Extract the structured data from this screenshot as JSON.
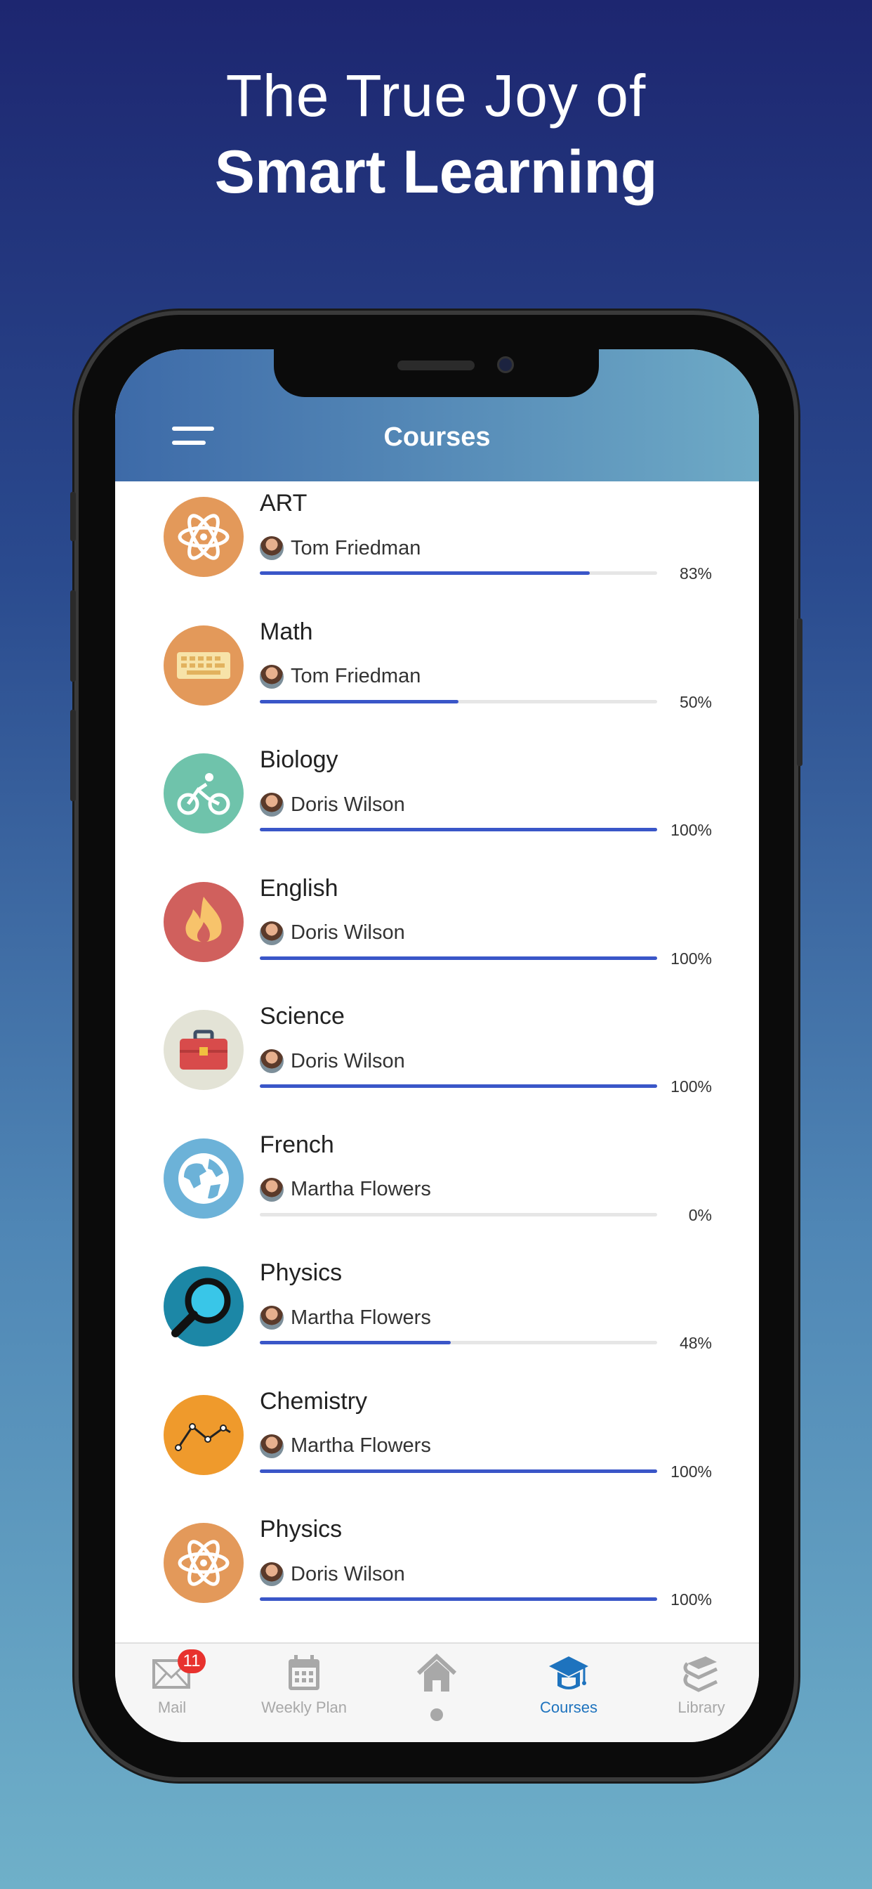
{
  "promo": {
    "line1": "The True Joy of",
    "line2": "Smart Learning"
  },
  "header": {
    "title": "Courses",
    "menu_icon": "hamburger-menu-icon"
  },
  "colors": {
    "progress": "#3a56c8",
    "active_tab": "#1e73be",
    "badge": "#e8322e"
  },
  "courses": [
    {
      "name": "ART",
      "teacher": "Tom Friedman",
      "progress": 83,
      "percent_label": "83%",
      "icon": "atom-icon",
      "icon_bg": "#e3995a"
    },
    {
      "name": "Math",
      "teacher": "Tom Friedman",
      "progress": 50,
      "percent_label": "50%",
      "icon": "keyboard-icon",
      "icon_bg": "#e3995a"
    },
    {
      "name": "Biology",
      "teacher": "Doris Wilson",
      "progress": 100,
      "percent_label": "100%",
      "icon": "bicycle-icon",
      "icon_bg": "#6fc3ab"
    },
    {
      "name": "English",
      "teacher": "Doris Wilson",
      "progress": 100,
      "percent_label": "100%",
      "icon": "flame-icon",
      "icon_bg": "#d0605d"
    },
    {
      "name": "Science",
      "teacher": "Doris Wilson",
      "progress": 100,
      "percent_label": "100%",
      "icon": "toolbox-icon",
      "icon_bg": "#e3e3d6"
    },
    {
      "name": "French",
      "teacher": "Martha Flowers",
      "progress": 0,
      "percent_label": "0%",
      "icon": "globe-icon",
      "icon_bg": "#6cb2d8"
    },
    {
      "name": "Physics",
      "teacher": "Martha Flowers",
      "progress": 48,
      "percent_label": "48%",
      "icon": "magnifier-icon",
      "icon_bg": "#1c87a6"
    },
    {
      "name": "Chemistry",
      "teacher": "Martha Flowers",
      "progress": 100,
      "percent_label": "100%",
      "icon": "line-chart-icon",
      "icon_bg": "#ef9a2c"
    },
    {
      "name": "Physics",
      "teacher": "Doris Wilson",
      "progress": 100,
      "percent_label": "100%",
      "icon": "atom-icon",
      "icon_bg": "#e3995a"
    }
  ],
  "tabs": [
    {
      "label": "Mail",
      "icon": "mail-icon",
      "badge": "11"
    },
    {
      "label": "Weekly Plan",
      "icon": "calendar-icon"
    },
    {
      "label": "",
      "icon": "home-icon"
    },
    {
      "label": "Courses",
      "icon": "graduation-cap-icon",
      "active": true
    },
    {
      "label": "Library",
      "icon": "books-icon"
    }
  ]
}
